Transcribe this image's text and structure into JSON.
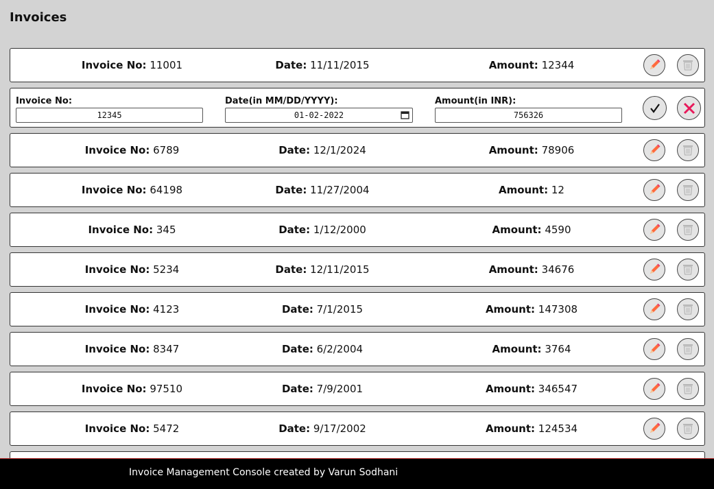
{
  "page": {
    "title": "Invoices"
  },
  "labels": {
    "invoice_no": "Invoice No:",
    "date": "Date:",
    "amount": "Amount:"
  },
  "edit_form": {
    "invoice_label": "Invoice No:",
    "invoice_value": "12345",
    "date_label": "Date(in MM/DD/YYYY):",
    "date_value": "01-02-2022",
    "amount_label": "Amount(in INR):",
    "amount_value": "756326"
  },
  "invoices": [
    {
      "invoice_no": "11001",
      "date": "11/11/2015",
      "amount": "12344"
    },
    {
      "invoice_no": "6789",
      "date": "12/1/2024",
      "amount": "78906"
    },
    {
      "invoice_no": "64198",
      "date": "11/27/2004",
      "amount": "12"
    },
    {
      "invoice_no": "345",
      "date": "1/12/2000",
      "amount": "4590"
    },
    {
      "invoice_no": "5234",
      "date": "12/11/2015",
      "amount": "34676"
    },
    {
      "invoice_no": "4123",
      "date": "7/1/2015",
      "amount": "147308"
    },
    {
      "invoice_no": "8347",
      "date": "6/2/2004",
      "amount": "3764"
    },
    {
      "invoice_no": "97510",
      "date": "7/9/2001",
      "amount": "346547"
    },
    {
      "invoice_no": "5472",
      "date": "9/17/2002",
      "amount": "124534"
    }
  ],
  "icons": {
    "edit": "pencil-icon",
    "delete": "trash-icon",
    "confirm": "check-icon",
    "cancel": "close-icon",
    "calendar": "calendar-icon"
  },
  "colors": {
    "background": "#d3d3d3",
    "pencil": "#ff6a3d",
    "pencil_tip": "#e83a6a",
    "cancel_x": "#e8185a",
    "footer_bg": "#000000"
  },
  "footer": {
    "text": "Invoice Management Console created by Varun Sodhani"
  }
}
